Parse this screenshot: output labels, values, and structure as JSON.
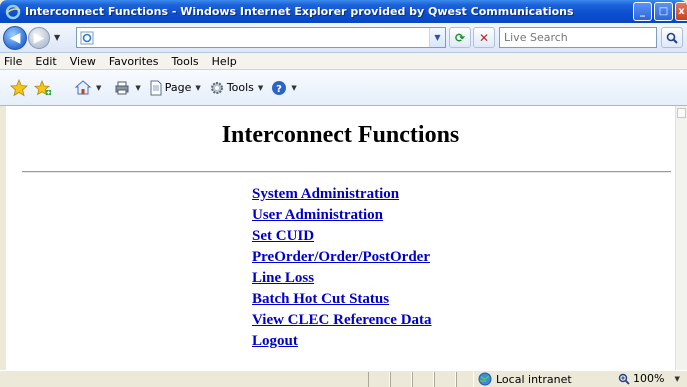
{
  "window": {
    "title": "Interconnect Functions - Windows Internet Explorer provided by Qwest Communications"
  },
  "address_bar": {
    "value": ""
  },
  "search": {
    "placeholder": "Live Search"
  },
  "menu": [
    {
      "label": "File"
    },
    {
      "label": "Edit"
    },
    {
      "label": "View"
    },
    {
      "label": "Favorites"
    },
    {
      "label": "Tools"
    },
    {
      "label": "Help"
    }
  ],
  "command_bar": {
    "page_label": "Page",
    "tools_label": "Tools"
  },
  "page": {
    "title": "Interconnect Functions",
    "links": [
      "System Administration",
      "User Administration",
      "Set CUID",
      "PreOrder/Order/PostOrder",
      "Line Loss",
      "Batch Hot Cut Status",
      "View CLEC Reference Data",
      "Logout"
    ]
  },
  "status_bar": {
    "zone": "Local intranet",
    "zoom": "100%"
  },
  "colors": {
    "link": "#0000cc",
    "titlebar": "#0a4fcf"
  }
}
